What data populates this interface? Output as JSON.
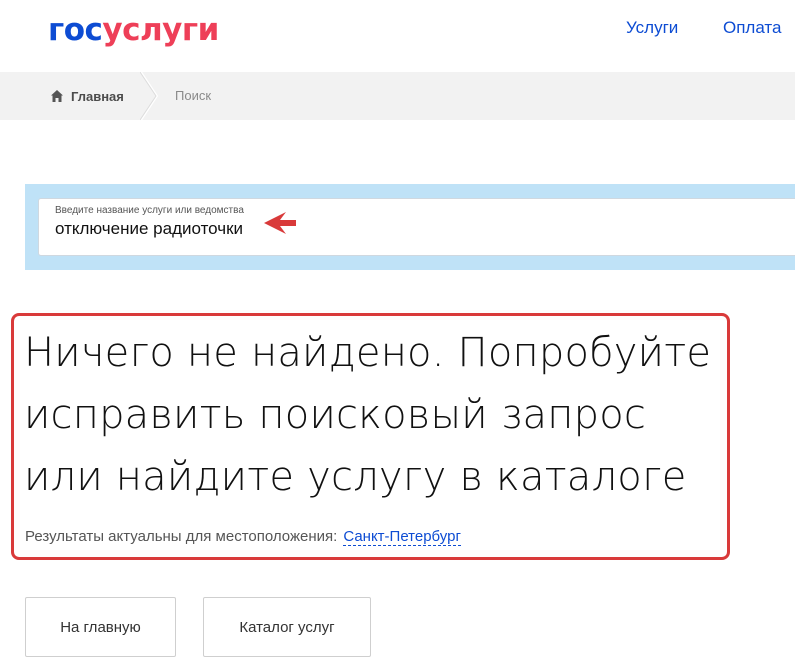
{
  "header": {
    "logo_part1": "гос",
    "logo_part2": "услуги",
    "nav": [
      "Услуги",
      "Оплата"
    ]
  },
  "breadcrumb": {
    "home": "Главная",
    "current": "Поиск"
  },
  "search": {
    "label": "Введите название услуги или ведомства",
    "value": "отключение радиоточки"
  },
  "result": {
    "title": "Ничего не найдено. Попробуйте исправить поисковый запрос или найдите услугу в каталоге",
    "location_note": "Результаты актуальны для местоположения:",
    "location": "Санкт-Петербург"
  },
  "buttons": {
    "home": "На главную",
    "catalog": "Каталог услуг"
  },
  "colors": {
    "brand_blue": "#0d4cd3",
    "brand_red": "#ee3f58",
    "annotation_red": "#d93a3a",
    "search_band": "#bfe2f7"
  },
  "icons": [
    "home-icon",
    "breadcrumb-separator-icon",
    "annotation-arrow-icon"
  ]
}
